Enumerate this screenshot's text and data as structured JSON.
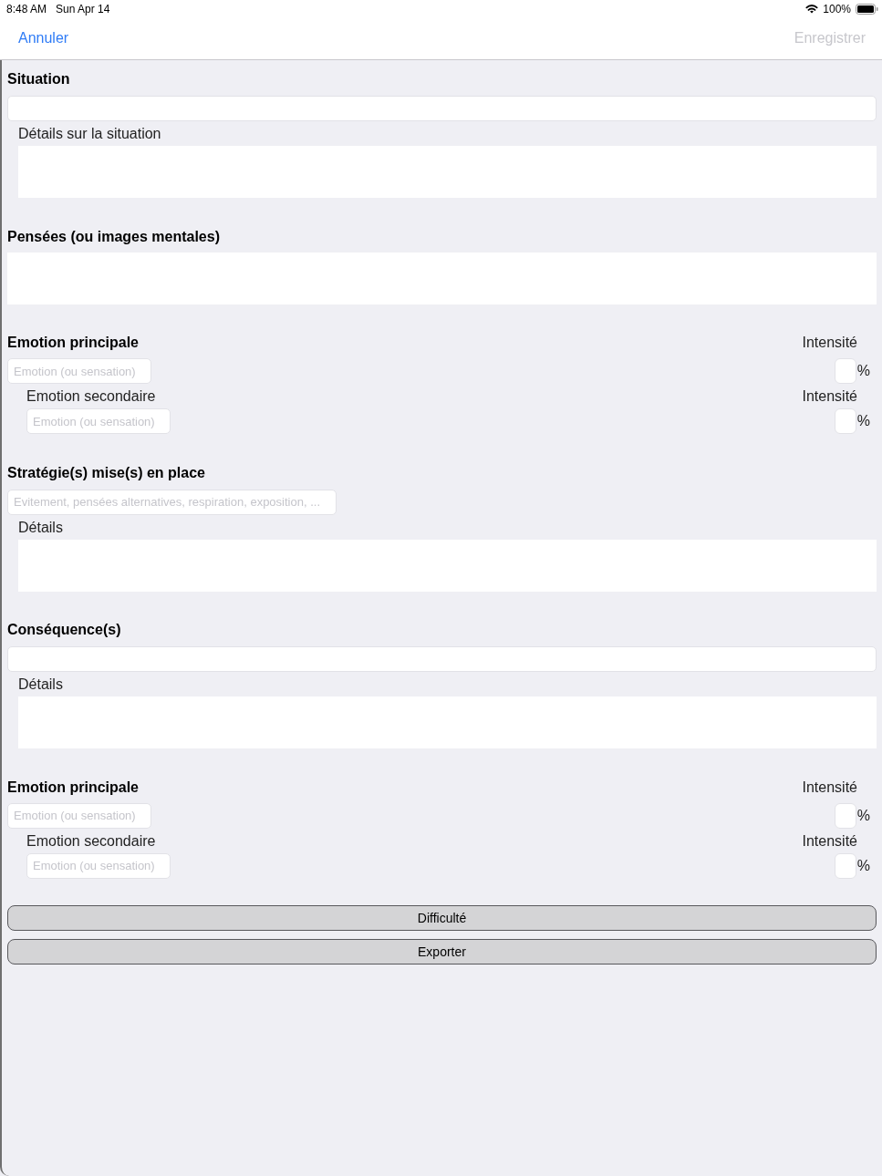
{
  "status_bar": {
    "time": "8:48 AM",
    "date": "Sun Apr 14",
    "battery": "100%"
  },
  "nav_bar": {
    "buttons": [
      {
        "label": "Annuler",
        "disabled": false
      },
      {
        "label": "Enregistrer",
        "disabled": true
      }
    ]
  },
  "sections": [
    {
      "kind": "field_with_details",
      "title": "Situation",
      "details_label": "Détails sur la situation"
    },
    {
      "kind": "text_area",
      "title": "Pensées (ou images mentales)"
    },
    {
      "kind": "emotions",
      "title": "Emotion principale",
      "intensity_label": "Intensité",
      "placeholder": "Emotion (ou sensation)",
      "unit": "%",
      "secondary": {
        "title": "Emotion secondaire",
        "intensity_label": "Intensité",
        "placeholder": "Emotion (ou sensation)",
        "unit": "%"
      }
    },
    {
      "kind": "field_with_details",
      "title": "Stratégie(s) mise(s) en place",
      "placeholder": "Evitement, pensées alternatives, respiration, exposition, ...",
      "details_label": "Détails"
    },
    {
      "kind": "field_with_details",
      "title": "Conséquence(s)",
      "details_label": "Détails"
    },
    {
      "kind": "emotions",
      "title": "Emotion principale",
      "intensity_label": "Intensité",
      "placeholder": "Emotion (ou sensation)",
      "unit": "%",
      "secondary": {
        "title": "Emotion secondaire",
        "intensity_label": "Intensité",
        "placeholder": "Emotion (ou sensation)",
        "unit": "%"
      }
    }
  ],
  "buttons": [
    {
      "label": "Difficulté"
    },
    {
      "label": "Exporter"
    }
  ]
}
